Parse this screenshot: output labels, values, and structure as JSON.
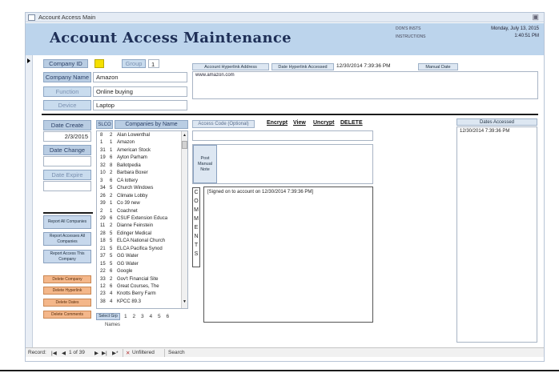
{
  "window": {
    "title": "Account Access Main"
  },
  "header": {
    "app_title": "Account Access Maintenance",
    "link1": "DON'S INSTS",
    "link2": "INSTRUCTIONS",
    "date": "Monday, July 13, 2015",
    "time": "1:40:51 PM"
  },
  "company": {
    "id_label": "Company ID",
    "id_value": "",
    "group_label": "Group",
    "group_value": "1",
    "name_label": "Company Name",
    "name_value": "Amazon",
    "function_label": "Function",
    "function_value": "Online buying",
    "device_label": "Device",
    "device_value": "Laptop"
  },
  "hyperlink": {
    "label": "Account Hyperlink Address",
    "accessed_label": "Date Hyperlink Accessed",
    "accessed_value": "12/30/2014 7:39:36 PM",
    "manual_button": "Manual Date",
    "url": "www.amazon.com"
  },
  "dates": {
    "create_label": "Date Create",
    "create_value": "2/3/2015",
    "change_label": "Date Change",
    "change_value": "",
    "expire_label": "Date Expire",
    "expire_value": ""
  },
  "buttons": {
    "report_all": "Report All Companies",
    "report_accesses_all": "Report Accesses All Companies",
    "report_access_this": "Report Access This Company",
    "delete_company": "Delete Company",
    "delete_hyperlink": "Delete Hyperlink",
    "delete_dates": "Delete Dates",
    "delete_comments": "Delete Comments"
  },
  "companies": {
    "count_header": "SLCO",
    "header": "Companies by Name",
    "items": [
      {
        "id": "8",
        "group": "2",
        "name": "Alan Lowenthal"
      },
      {
        "id": "1",
        "group": "1",
        "name": "Amazon"
      },
      {
        "id": "31",
        "group": "1",
        "name": "American Stock"
      },
      {
        "id": "19",
        "group": "6",
        "name": "Ayton Parham"
      },
      {
        "id": "32",
        "group": "8",
        "name": "Ballotpedia"
      },
      {
        "id": "10",
        "group": "2",
        "name": "Barbara Boxer"
      },
      {
        "id": "3",
        "group": "6",
        "name": "CA lottery"
      },
      {
        "id": "34",
        "group": "5",
        "name": "Church Windows"
      },
      {
        "id": "26",
        "group": "2",
        "name": "Climate Lobby"
      },
      {
        "id": "39",
        "group": "1",
        "name": "Co 39 new"
      },
      {
        "id": "2",
        "group": "1",
        "name": "Coachnet"
      },
      {
        "id": "29",
        "group": "6",
        "name": "CSUF Extension Educa"
      },
      {
        "id": "11",
        "group": "2",
        "name": "Dianne Feinstein"
      },
      {
        "id": "28",
        "group": "5",
        "name": "Edinger Medical"
      },
      {
        "id": "18",
        "group": "5",
        "name": "ELCA National Church"
      },
      {
        "id": "21",
        "group": "5",
        "name": "ELCA Pacifica Synod"
      },
      {
        "id": "37",
        "group": "5",
        "name": "GG Water"
      },
      {
        "id": "15",
        "group": "5",
        "name": "GG Water"
      },
      {
        "id": "22",
        "group": "6",
        "name": "Google"
      },
      {
        "id": "33",
        "group": "2",
        "name": "Gov't Financial Site"
      },
      {
        "id": "12",
        "group": "6",
        "name": "Great Courses, The"
      },
      {
        "id": "23",
        "group": "4",
        "name": "Knotts Berry Farm"
      },
      {
        "id": "38",
        "group": "4",
        "name": "KPCC 89.3"
      }
    ],
    "select_grp_button": "Select Grp",
    "group_numbers": [
      "1",
      "2",
      "3",
      "4",
      "5",
      "6"
    ],
    "names_caption": "Names"
  },
  "access_code": {
    "label": "Access Code (Optional)",
    "encrypt": "Encrypt",
    "view": "View",
    "unencrypt": "Uncrypt",
    "delete": "DELETE",
    "post_manual_note": "Post Manual Note"
  },
  "comments": {
    "side_label": "COMMENTS",
    "text": "[Signed on to account on 12/30/2014 7:39:36 PM]"
  },
  "dates_accessed": {
    "header": "Dates Accessed",
    "items": [
      "12/30/2014 7:39:36 PM"
    ]
  },
  "navbar": {
    "record_label": "Record:",
    "first": "|◀",
    "prev": "◀",
    "position": "1 of 39",
    "next": "▶",
    "last": "▶|",
    "new": "▶*",
    "filter": "Unfiltered",
    "search": "Search"
  },
  "colors": {
    "header_bg": "#bcd4ec",
    "title_color": "#1e2f57",
    "label_bg": "#b9cde3",
    "orange_button": "#f4b78a",
    "company_id_highlight": "#f5e000"
  }
}
